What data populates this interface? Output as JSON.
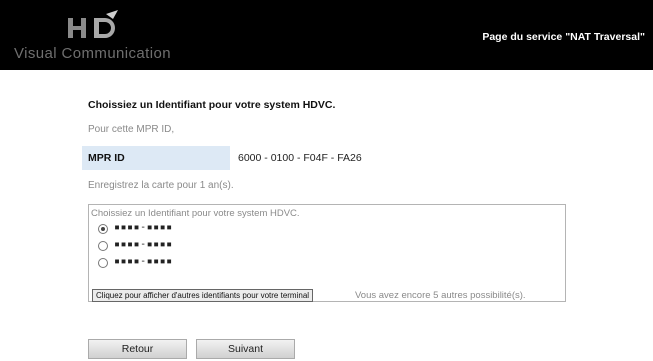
{
  "header": {
    "logo_text": "Visual Communication",
    "service_title": "Page du service \"NAT Traversal\""
  },
  "form": {
    "heading": "Choissiez un Identifiant pour votre system HDVC.",
    "for_mpr_label": "Pour cette MPR ID,",
    "mpr_label": "MPR ID",
    "mpr_value": "6000 - 0100 - F04F - FA26",
    "register_label": "Enregistrez la carte pour 1 an(s).",
    "options_legend": "Choissiez un Identifiant pour votre system HDVC.",
    "options": [
      {
        "value": "▪▪▪▪-▪▪▪▪",
        "selected": true
      },
      {
        "value": "▪▪▪▪-▪▪▪▪",
        "selected": false
      },
      {
        "value": "▪▪▪▪-▪▪▪▪",
        "selected": false
      }
    ],
    "more_button_label": "Cliquez pour afficher d'autres identifiants pour votre terminal",
    "remaining_text": "Vous avez encore 5 autres possibilité(s)."
  },
  "buttons": {
    "back_label": "Retour",
    "next_label": "Suivant"
  },
  "colors": {
    "header_bg": "#000000",
    "mpr_cell_bg": "#dde9f5"
  }
}
